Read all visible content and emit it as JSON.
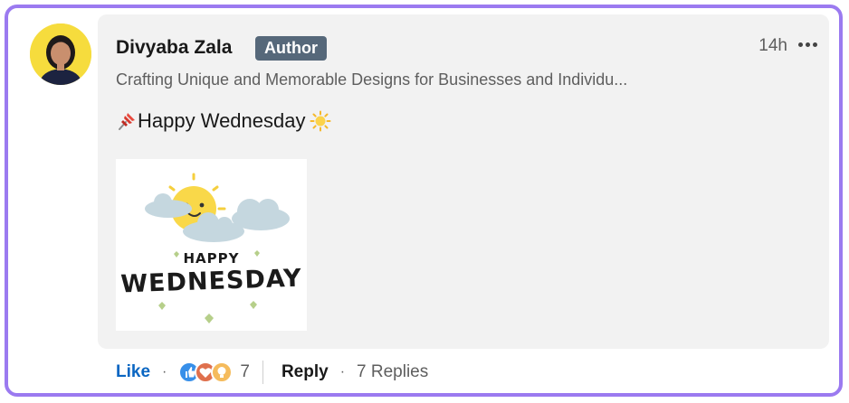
{
  "comment": {
    "author_name": "Divyaba Zala",
    "badge": "Author",
    "time": "14h",
    "headline": "Crafting Unique and Memorable Designs for Businesses and Individu...",
    "message": "Happy Wednesday",
    "message_emojis": [
      "pushpin-icon",
      "sun-icon"
    ],
    "image_text_small": "HAPPY",
    "image_text_big": "WEDNESDAY"
  },
  "actions": {
    "like_label": "Like",
    "reaction_icons": [
      "like-reaction-icon",
      "love-reaction-icon",
      "insightful-reaction-icon"
    ],
    "reaction_count": "7",
    "reply_label": "Reply",
    "replies_label": "7 Replies"
  },
  "colors": {
    "frame_border": "#9b7af0",
    "bubble_bg": "#f2f2f2",
    "badge_bg": "#56687a",
    "link_blue": "#0a66c2"
  }
}
